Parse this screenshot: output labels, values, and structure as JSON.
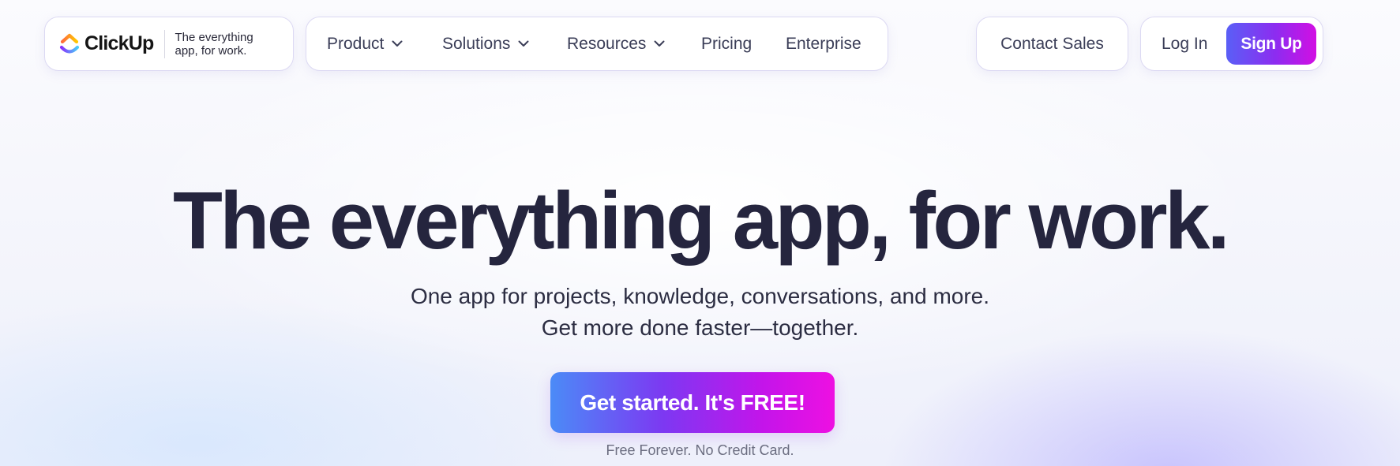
{
  "header": {
    "brand": {
      "name": "ClickUp",
      "tagline": "The everything app, for work."
    },
    "nav": {
      "items": [
        {
          "label": "Product",
          "has_dropdown": true,
          "icon": "chevron-down-icon"
        },
        {
          "label": "Solutions",
          "has_dropdown": true,
          "icon": "chevron-down-icon"
        },
        {
          "label": "Resources",
          "has_dropdown": true,
          "icon": "chevron-down-icon"
        },
        {
          "label": "Pricing",
          "has_dropdown": false
        },
        {
          "label": "Enterprise",
          "has_dropdown": false
        }
      ]
    },
    "contact_sales": "Contact Sales",
    "login": "Log In",
    "signup": "Sign Up"
  },
  "hero": {
    "title": "The everything app, for work.",
    "subtitle_line1": "One app for projects, knowledge, conversations, and more.",
    "subtitle_line2": "Get more done faster—together.",
    "cta": "Get started. It's FREE!",
    "cta_note": "Free Forever. No Credit Card."
  },
  "colors": {
    "text_dark": "#25253e",
    "cta_gradient_start": "#4b8bf7",
    "cta_gradient_mid": "#7d38f2",
    "cta_gradient_end": "#ee10e2",
    "signup_gradient_start": "#5a5ff6",
    "signup_gradient_end": "#d20fe3",
    "pill_border": "#dcd9f3"
  }
}
